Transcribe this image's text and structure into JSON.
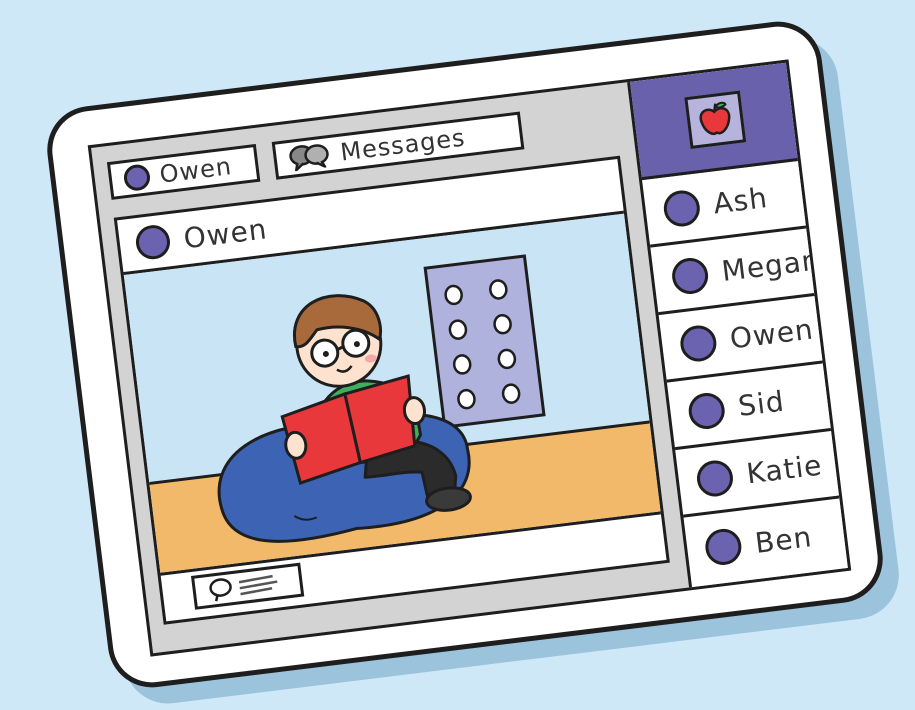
{
  "header": {
    "profile_name": "Owen",
    "messages_label": "Messages"
  },
  "post": {
    "author": "Owen"
  },
  "sidebar": {
    "contacts": [
      {
        "name": "Ash"
      },
      {
        "name": "Megan"
      },
      {
        "name": "Owen"
      },
      {
        "name": "Sid"
      },
      {
        "name": "Katie"
      },
      {
        "name": "Ben"
      }
    ]
  },
  "colors": {
    "background": "#cfe8f7",
    "accent_purple": "#6961ab",
    "avatar_dot": "#6b62b0",
    "book_red": "#e8383b",
    "floor": "#f2b96a",
    "wall": "#c9e5f5"
  },
  "icons": [
    "speech-bubbles-icon",
    "apple-logo-icon",
    "comment-icon"
  ]
}
